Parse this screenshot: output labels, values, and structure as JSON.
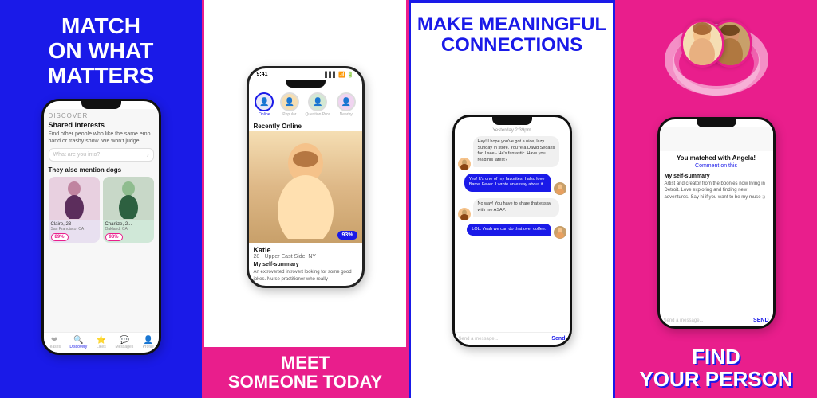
{
  "panel1": {
    "headline_line1": "MATCH",
    "headline_line2": "ON WHAT MATTERS",
    "discover_label": "DISCOVER",
    "shared_interests_title": "Shared interests",
    "shared_interests_desc": "Find other people who like the same emo band or trashy show. We won't judge.",
    "search_placeholder": "What are you into?",
    "also_mention": "They also mention dogs",
    "profile1_name": "Claire, 23",
    "profile1_location": "San Francisco, CA",
    "profile1_match": "89%",
    "profile2_name": "Charlize, 2...",
    "profile2_location": "Oakland, CA",
    "profile2_match": "93%",
    "nav_items": [
      "Teases/Likes",
      "Discovery",
      "Likes",
      "Messages",
      "Profile"
    ]
  },
  "panel2": {
    "status_bar_time": "9:41",
    "status_bar_signal": "▌▌▌",
    "tab_items": [
      "Online",
      "Popular",
      "Question Pros",
      "Nearby"
    ],
    "recently_online": "Recently Online",
    "profile_name": "Katie",
    "profile_age_loc": "28 · Upper East Side, NY",
    "match_pct": "93%",
    "self_summary_label": "My self-summary",
    "self_summary_text": "An extroverted introvert looking for some good jokes. Nurse practitioner who really",
    "bottom_cta_line1": "MEET",
    "bottom_cta_line2": "SOMEONE TODAY"
  },
  "panel3": {
    "headline_line1": "MAKE MEANINGFUL",
    "headline_line2": "CONNECTIONS",
    "chat_date": "Yesterday 2:39pm",
    "messages": [
      {
        "side": "received",
        "text": "Hey! I hope you've got a nice, lazy Sunday in store. You're a David Sedaris fan I see - He's fantastic. Have you read his latest?"
      },
      {
        "side": "sent",
        "text": "Yes! It's one of my favorites. I also love Barrel Fever. I wrote an essay about it."
      },
      {
        "side": "received",
        "text": "No way! You have to share that essay with me ASAP."
      },
      {
        "side": "sent",
        "text": "LOL. Yeah we can do that over coffee."
      }
    ],
    "input_placeholder": "Send a message...",
    "send_label": "Send"
  },
  "panel4": {
    "headline_line1": "FIND",
    "headline_line2": "YOUR PERSON",
    "matched_text": "You matched with Angela!",
    "comment_text": "Comment on this",
    "self_summary_label": "My self-summary",
    "self_summary_text": "Artist and creator from the boonies now living in Detroit. Love exploring and finding new adventures. Say hi if you want to be my muse ;)",
    "input_placeholder": "Send a message...",
    "send_label": "SEND"
  }
}
